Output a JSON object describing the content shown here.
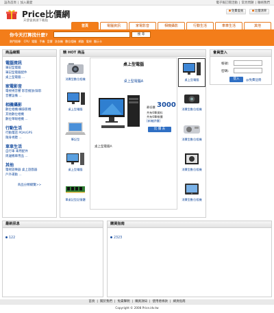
{
  "topbar": {
    "left_links": [
      "設為首頁",
      "加入最愛"
    ],
    "right_links": [
      "電子報訂閱活動",
      "常見問題",
      "聯絡我們"
    ]
  },
  "logo": {
    "title": "Price比價網",
    "subtitle": "天使會員請下載點"
  },
  "top_buttons": {
    "member": "免費會員",
    "list": "比價清單"
  },
  "nav": {
    "tabs": [
      "首頁",
      "電腦資訊",
      "家電影音",
      "相機攝影",
      "行動生活",
      "車車生活",
      "其他"
    ],
    "active": 0
  },
  "search": {
    "question": "你今天打算找什麼?",
    "placeholder": "",
    "button": "搜 尋",
    "hot_label": "熱門搜尋:",
    "keywords": [
      "CPU",
      "電腦",
      "手機",
      "音響",
      "洗衣機",
      "數位相機",
      "網路",
      "電視",
      "顯示卡"
    ]
  },
  "sidebar": {
    "title": "商品總類",
    "sections": [
      {
        "name": "電腦資訊",
        "items": [
          "筆記型電腦",
          "筆記型電腦配件",
          "桌上型電腦 ..."
        ]
      },
      {
        "name": "家電影音",
        "items": [
          "電視視音響    影音播放/錄影",
          "音響設備 ..."
        ]
      },
      {
        "name": "相機攝影",
        "items": [
          "數位相機/攝錄影機",
          "其他數位相機",
          "數位單眼相機 ..."
        ]
      },
      {
        "name": "行動生活",
        "items": [
          "行動電話     PDA/GPS",
          "隨身視聽 ..."
        ]
      },
      {
        "name": "車車生活",
        "items": [
          "自行車     車用配件",
          "周邊機車用品 ..."
        ]
      },
      {
        "name": "其他",
        "items": [
          "電視遊樂器    桌上遊戲器",
          "戶外運動 ..."
        ]
      }
    ],
    "more": "商品分類總覽>>"
  },
  "hot": {
    "title": "精 HOT 商品",
    "left_products": [
      "消費型數位相機",
      "桌上型電腦",
      "筆記型",
      "桌上型電腦",
      "單桌記型記憶體"
    ],
    "right_products": [
      "桌上型電腦",
      "消費型數位相機",
      "消費型數位相機",
      "消費型數位相機",
      "消費型數位相機"
    ],
    "feature": {
      "title": "桌上型電腦",
      "subtitle": "桌上型電腦A",
      "price_label": "最低價",
      "price": "3000",
      "line1": "共有6筆資料",
      "line2": "共有6筆報價",
      "line3": "[新機評價]",
      "button": "比 價 去",
      "caption": "桌上型電腦A"
    }
  },
  "login": {
    "title": "會員登入",
    "account_label": "帳號:",
    "password_label": "密碼:",
    "button": "登入",
    "register": "@免費註冊"
  },
  "news": {
    "title": "最新訊息",
    "items": [
      "122"
    ]
  },
  "guide": {
    "title": "購買指南",
    "items": [
      "2323"
    ]
  },
  "footer": {
    "links": [
      "首頁",
      "關於我們",
      "免責聲明",
      "購買須知",
      "使用者條款",
      "網頁指南"
    ],
    "copyright": "Copyright © 2008 Price.idv.tw"
  }
}
